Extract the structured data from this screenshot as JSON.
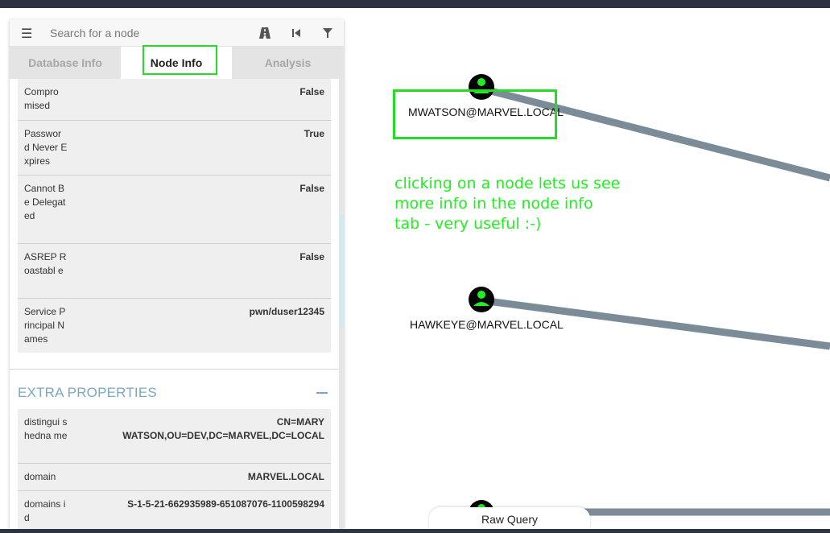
{
  "search": {
    "placeholder": "Search for a node"
  },
  "icons": {
    "menu": "hamburger-icon",
    "pathfinding": "road-icon",
    "back": "skip-back-icon",
    "filter": "filter-icon",
    "user": "user-icon"
  },
  "tabs": [
    {
      "label": "Database Info",
      "active": false
    },
    {
      "label": "Node Info",
      "active": true
    },
    {
      "label": "Analysis",
      "active": false
    }
  ],
  "properties": [
    {
      "key": "Compro mised",
      "value": "False"
    },
    {
      "key": "Passwor d Never Expires",
      "value": "True"
    },
    {
      "key": "Cannot Be Delegat ed",
      "value": "False"
    },
    {
      "key": "ASREP Roastabl e",
      "value": "False"
    },
    {
      "key": "Service Principal Names",
      "value": "pwn/duser12345"
    }
  ],
  "extra": {
    "title": "EXTRA PROPERTIES",
    "rows": [
      {
        "key": "distingui shedna me",
        "value": "CN=MARY WATSON,OU=DEV,DC=MARVEL,DC=LOCAL"
      },
      {
        "key": "domain",
        "value": "MARVEL.LOCAL"
      },
      {
        "key": "domains id",
        "value": "S-1-5-21-662935989-651087076-1100598294"
      }
    ]
  },
  "graph": {
    "nodes": [
      {
        "label": "MWATSON@MARVEL.LOCAL"
      },
      {
        "label": "HAWKEYE@MARVEL.LOCAL"
      }
    ],
    "annotation": [
      "clicking on a node lets us see",
      "more info in the node info",
      "tab - very useful :-)"
    ]
  },
  "raw_query": {
    "label": "Raw Query"
  },
  "colors": {
    "edge": "#7b8c98",
    "node_icon": "#22ee22",
    "highlight": "#22dd22",
    "section_title": "#7aa7c2"
  }
}
